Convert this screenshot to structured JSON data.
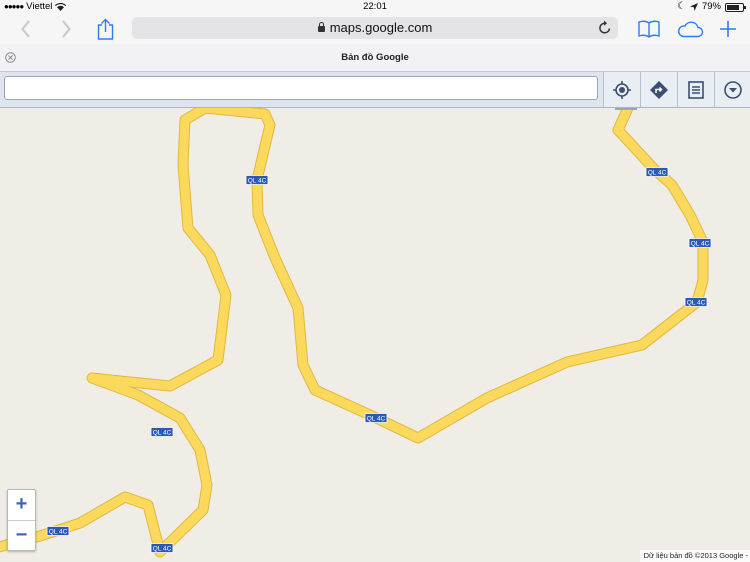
{
  "status_bar": {
    "carrier": "Viettel",
    "time": "22:01",
    "battery_text": "79%",
    "battery_level": 0.79
  },
  "browser": {
    "url": "maps.google.com",
    "tab_title": "Bản đồ Google",
    "accent_color": "#2d7cf6"
  },
  "search": {
    "value": "",
    "placeholder": ""
  },
  "map": {
    "road_label": "QL 4C",
    "road_color": "#fbd95c",
    "road_edge_color": "#e2b83f",
    "land_color": "#efede6",
    "attribution": "Dữ liệu bản đồ ©2013 Google -"
  },
  "zoom": {
    "in_label": "+",
    "out_label": "−"
  },
  "icons": [
    "signal-dots-icon",
    "wifi-icon",
    "moon-icon",
    "location-arrow-icon",
    "back-icon",
    "forward-icon",
    "share-icon",
    "lock-icon",
    "reload-icon",
    "bookmarks-icon",
    "icloud-tabs-icon",
    "new-tab-icon",
    "close-tab-icon",
    "my-location-icon",
    "directions-icon",
    "list-icon",
    "menu-dropdown-icon"
  ]
}
